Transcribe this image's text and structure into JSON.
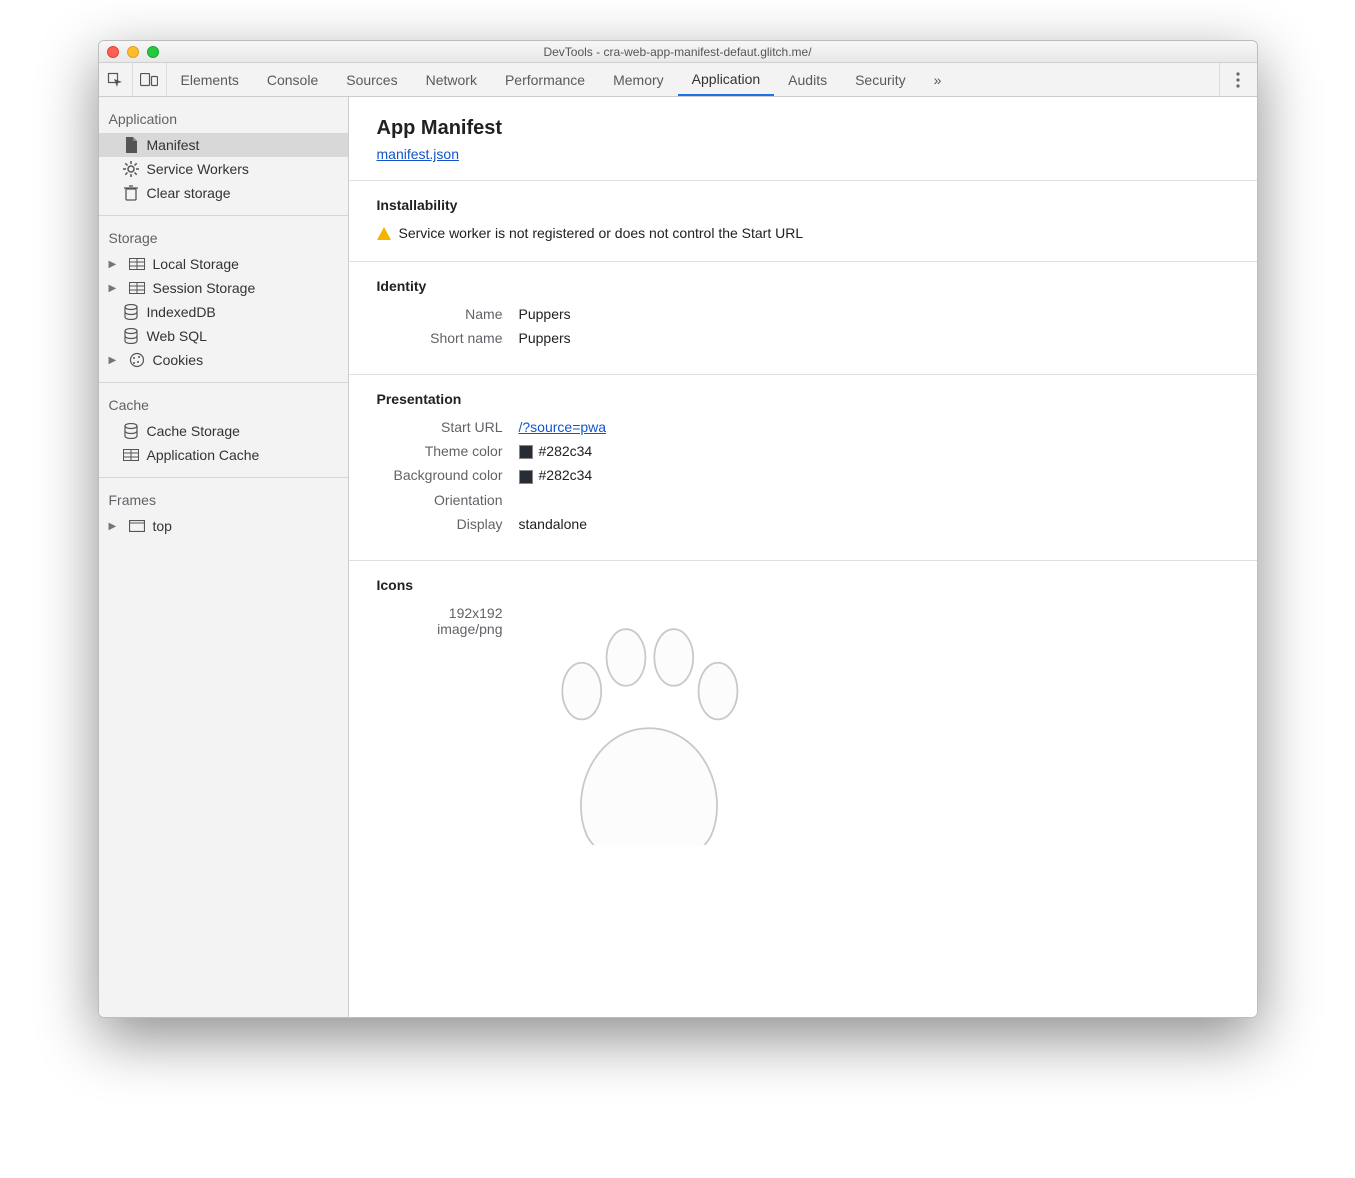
{
  "window_title": "DevTools - cra-web-app-manifest-defaut.glitch.me/",
  "tabs": {
    "elements": "Elements",
    "console": "Console",
    "sources": "Sources",
    "network": "Network",
    "performance": "Performance",
    "memory": "Memory",
    "application": "Application",
    "audits": "Audits",
    "security": "Security",
    "overflow": "»"
  },
  "sidebar": {
    "application": {
      "title": "Application",
      "manifest": "Manifest",
      "service_workers": "Service Workers",
      "clear_storage": "Clear storage"
    },
    "storage": {
      "title": "Storage",
      "local_storage": "Local Storage",
      "session_storage": "Session Storage",
      "indexeddb": "IndexedDB",
      "web_sql": "Web SQL",
      "cookies": "Cookies"
    },
    "cache": {
      "title": "Cache",
      "cache_storage": "Cache Storage",
      "application_cache": "Application Cache"
    },
    "frames": {
      "title": "Frames",
      "top": "top"
    }
  },
  "main": {
    "heading": "App Manifest",
    "manifest_link": "manifest.json",
    "installability": {
      "heading": "Installability",
      "warning": "Service worker is not registered or does not control the Start URL"
    },
    "identity": {
      "heading": "Identity",
      "name_label": "Name",
      "name_value": "Puppers",
      "short_name_label": "Short name",
      "short_name_value": "Puppers"
    },
    "presentation": {
      "heading": "Presentation",
      "start_url_label": "Start URL",
      "start_url_value": "/?source=pwa",
      "theme_color_label": "Theme color",
      "theme_color_value": "#282c34",
      "background_color_label": "Background color",
      "background_color_value": "#282c34",
      "orientation_label": "Orientation",
      "orientation_value": "",
      "display_label": "Display",
      "display_value": "standalone"
    },
    "icons": {
      "heading": "Icons",
      "size": "192x192",
      "mime": "image/png"
    },
    "colors": {
      "theme": "#282c34",
      "background": "#282c34"
    }
  }
}
